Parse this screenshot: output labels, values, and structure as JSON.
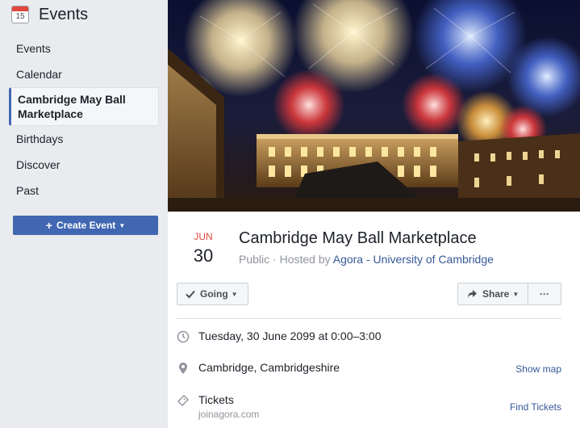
{
  "sidebar": {
    "title": "Events",
    "calendar_day": "15",
    "items": [
      {
        "label": "Events"
      },
      {
        "label": "Calendar"
      },
      {
        "label": "Cambridge May Ball Marketplace"
      },
      {
        "label": "Birthdays"
      },
      {
        "label": "Discover"
      },
      {
        "label": "Past"
      }
    ],
    "create_label": "Create Event"
  },
  "event": {
    "month": "JUN",
    "day": "30",
    "title": "Cambridge May Ball Marketplace",
    "privacy": "Public",
    "hosted_prefix": " · Hosted by ",
    "host": "Agora - University of Cambridge",
    "going_label": "Going",
    "share_label": "Share",
    "more_label": "···",
    "datetime": "Tuesday, 30 June 2099 at 0:00–3:00",
    "location": "Cambridge, Cambridgeshire",
    "show_map": "Show map",
    "tickets_label": "Tickets",
    "tickets_site": "joinagora.com",
    "find_tickets": "Find Tickets"
  },
  "colors": {
    "accent": "#4267b2",
    "link": "#365899",
    "month": "#e0463c"
  }
}
